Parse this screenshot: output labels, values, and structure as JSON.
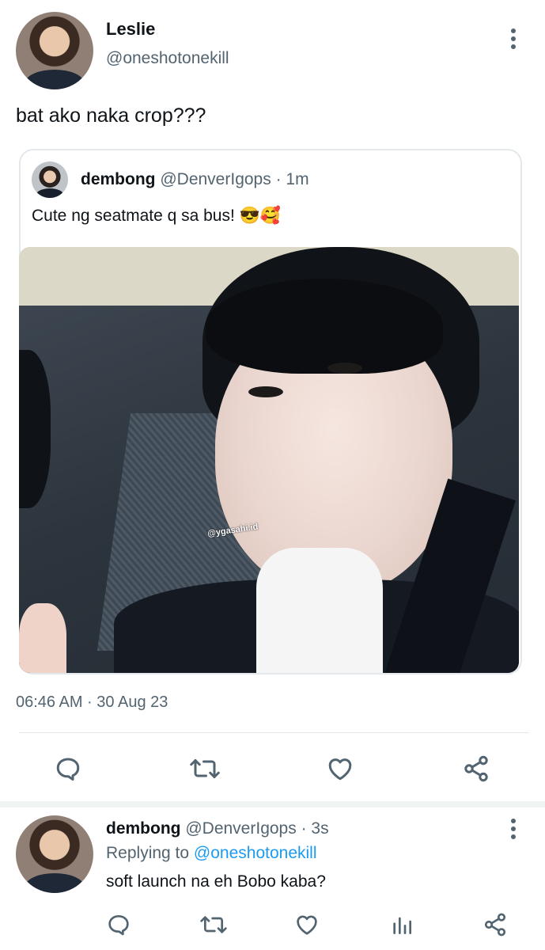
{
  "tweet": {
    "author_name": "Leslie",
    "author_handle": "@oneshotonekill",
    "text": "bat ako naka crop???",
    "timestamp": "06:46 AM · 30 Aug 23",
    "quoted": {
      "author_name": "dembong",
      "author_handle": "@DenverIgops",
      "time": "· 1m",
      "text": "Cute ng seatmate q sa bus! 😎🥰",
      "image_watermark": "@ygasahi.id"
    },
    "actions": [
      "reply-icon",
      "retweet-icon",
      "like-icon",
      "share-icon"
    ]
  },
  "reply": {
    "author_name": "dembong",
    "author_handle": "@DenverIgops",
    "time": "· 3s",
    "replying_prefix": "Replying to",
    "replying_handle": "@oneshotonekill",
    "text": "soft launch na eh Bobo kaba?",
    "actions": [
      "reply-icon",
      "retweet-icon",
      "like-icon",
      "analytics-icon",
      "share-icon"
    ]
  },
  "colors": {
    "accent": "#1d9bf0",
    "muted": "#536471",
    "border": "#e3e8ec"
  }
}
